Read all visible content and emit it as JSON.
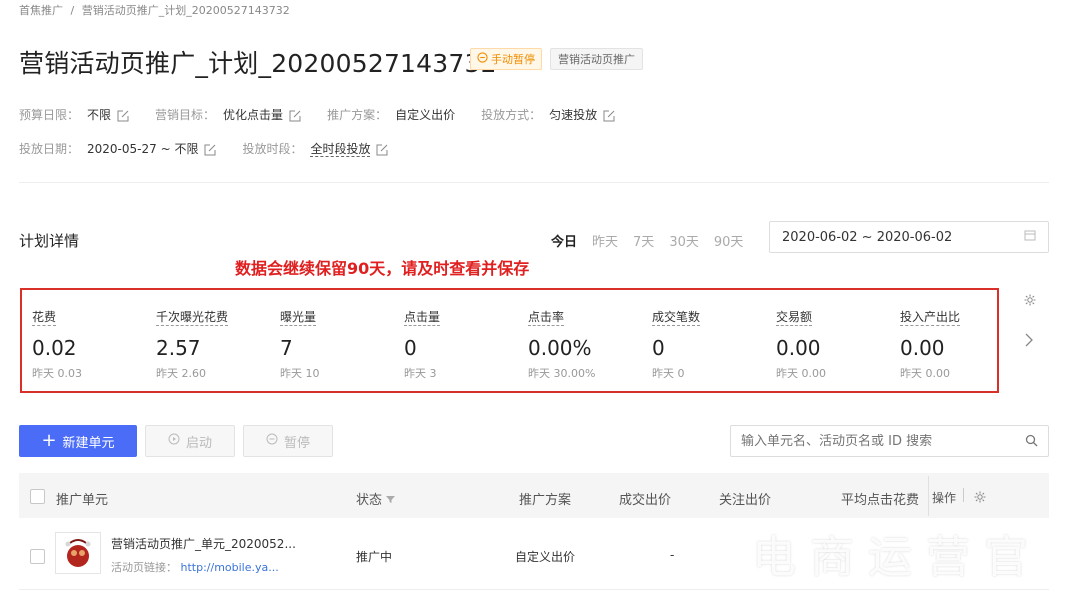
{
  "breadcrumb": {
    "root": "首焦推广",
    "separator": "/",
    "current": "营销活动页推广_计划_20200527143732"
  },
  "page_title": "营销活动页推广_计划_20200527143732",
  "status_tag": "手动暂停",
  "type_tag": "营销活动页推广",
  "meta": {
    "budget_label": "预算日限：",
    "budget_value": "不限",
    "goal_label": "营销目标：",
    "goal_value": "优化点击量",
    "plan_label": "推广方案：",
    "plan_value": "自定义出价",
    "delivery_label": "投放方式：",
    "delivery_value": "匀速投放",
    "date_label": "投放日期：",
    "date_value": "2020-05-27 ~ 不限",
    "time_label": "投放时段：",
    "time_value": "全时段投放"
  },
  "section_title": "计划详情",
  "notice": "数据会继续保留90天，请及时查看并保存",
  "date_tabs": [
    "今日",
    "昨天",
    "7天",
    "30天",
    "90天"
  ],
  "date_range": "2020-06-02 ~ 2020-06-02",
  "metrics": [
    {
      "label": "花费",
      "value": "0.02",
      "prev": "昨天 0.03"
    },
    {
      "label": "千次曝光花费",
      "value": "2.57",
      "prev": "昨天 2.60"
    },
    {
      "label": "曝光量",
      "value": "7",
      "prev": "昨天 10"
    },
    {
      "label": "点击量",
      "value": "0",
      "prev": "昨天 3"
    },
    {
      "label": "点击率",
      "value": "0.00%",
      "prev": "昨天 30.00%"
    },
    {
      "label": "成交笔数",
      "value": "0",
      "prev": "昨天 0"
    },
    {
      "label": "交易额",
      "value": "0.00",
      "prev": "昨天 0.00"
    },
    {
      "label": "投入产出比",
      "value": "0.00",
      "prev": "昨天 0.00"
    }
  ],
  "toolbar": {
    "new_unit": "新建单元",
    "start": "启动",
    "pause": "暂停",
    "search_placeholder": "输入单元名、活动页名或 ID 搜索"
  },
  "table": {
    "headers": {
      "unit": "推广单元",
      "status": "状态",
      "plan": "推广方案",
      "deal_bid": "成交出价",
      "follow_bid": "关注出价",
      "avg_click": "平均点击花费",
      "ops": "操作"
    },
    "rows": [
      {
        "name": "营销活动页推广_单元_2020052...",
        "link_label": "活动页链接：",
        "link": "http://mobile.ya...",
        "status": "推广中",
        "plan": "自定义出价",
        "deal_bid": "-"
      }
    ]
  },
  "watermark": "电商运营官",
  "colors": {
    "primary": "#4a6cf7",
    "alert": "#e02020",
    "orange": "#f08c00"
  }
}
